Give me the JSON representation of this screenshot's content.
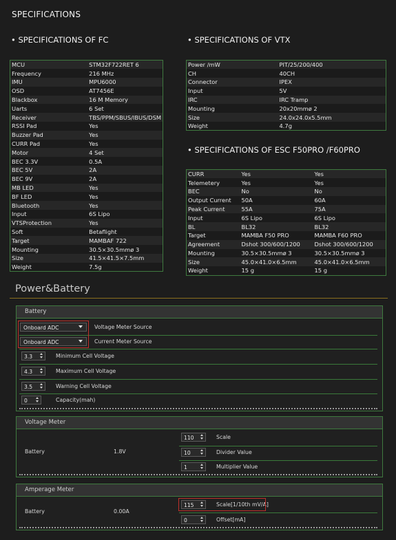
{
  "page_title": "SPECIFICATIONS",
  "fc": {
    "title": "• SPECIFICATIONS OF FC",
    "rows": [
      [
        "MCU",
        "STM32F722RET 6"
      ],
      [
        "Frequency",
        "216 MHz"
      ],
      [
        "IMU",
        "MPU6000"
      ],
      [
        "OSD",
        "AT7456E"
      ],
      [
        "Blackbox",
        "16 M Memory"
      ],
      [
        "Uarts",
        "6 Set"
      ],
      [
        "Receiver",
        "TBS/PPM/SBUS/IBUS/DSM"
      ],
      [
        "RSSI Pad",
        "Yes"
      ],
      [
        "Buzzer Pad",
        "Yes"
      ],
      [
        "CURR Pad",
        "Yes"
      ],
      [
        "Motor",
        "4 Set"
      ],
      [
        "BEC 3.3V",
        "0.5A"
      ],
      [
        "BEC 5V",
        "2A"
      ],
      [
        "BEC 9V",
        "2A"
      ],
      [
        "MB LED",
        "Yes"
      ],
      [
        "BF LED",
        "Yes"
      ],
      [
        "Bluetooth",
        "Yes"
      ],
      [
        "Input",
        "6S Lipo"
      ],
      [
        "VTSProtection",
        "Yes"
      ],
      [
        "Soft",
        "Betaflight"
      ],
      [
        "Target",
        "MAMBAF 722"
      ],
      [
        "Mounting",
        "30.5×30.5mmø 3"
      ],
      [
        "Size",
        "41.5×41.5×7.5mm"
      ],
      [
        "Weight",
        "7.5g"
      ]
    ]
  },
  "vtx": {
    "title": "• SPECIFICATIONS OF VTX",
    "rows": [
      [
        "Power /mW",
        "PIT/25/200/400"
      ],
      [
        "CH",
        "40CH"
      ],
      [
        "Connector",
        "IPEX"
      ],
      [
        "Input",
        "5V"
      ],
      [
        "IRC",
        "IRC Tramp"
      ],
      [
        "Mounting",
        "20x20mmø 2"
      ],
      [
        "Size",
        "24.0x24.0x5.5mm"
      ],
      [
        "Weight",
        "4.7g"
      ]
    ]
  },
  "esc": {
    "title": "• SPECIFICATIONS OF ESC F50PRO /F60PRO",
    "rows": [
      [
        "CURR",
        "Yes",
        "Yes"
      ],
      [
        "Telemetery",
        "Yes",
        "Yes"
      ],
      [
        "BEC",
        "No",
        "No"
      ],
      [
        "Output Current",
        "50A",
        "60A"
      ],
      [
        "Peak Current",
        "55A",
        "75A"
      ],
      [
        "Input",
        "6S Lipo",
        "6S Lipo"
      ],
      [
        "BL",
        "BL32",
        "BL32"
      ],
      [
        "Target",
        "MAMBA F50 PRO",
        "MAMBA F60 PRO"
      ],
      [
        "Agreement",
        "Dshot 300/600/1200",
        "Dshot 300/600/1200"
      ],
      [
        "Mounting",
        "30.5×30.5mmø 3",
        "30.5×30.5mmø 3"
      ],
      [
        "Size",
        "45.0×41.0×6.5mm",
        "45.0×41.0×6.5mm"
      ],
      [
        "Weight",
        "15 g",
        "15 g"
      ]
    ]
  },
  "power": {
    "title": "Power&Battery",
    "battery": {
      "header": "Battery",
      "voltage_source": {
        "value": "Onboard ADC",
        "label": "Voltage Meter Source"
      },
      "current_source": {
        "value": "Onboard ADC",
        "label": "Current Meter Source"
      },
      "min_cell": {
        "value": "3.3",
        "label": "Minimum Cell Voltage"
      },
      "max_cell": {
        "value": "4.3",
        "label": "Maximum Cell Voltage"
      },
      "warn_cell": {
        "value": "3.5",
        "label": "Warning Cell Voltage"
      },
      "capacity": {
        "value": "0",
        "label": "Capacity(mah)"
      }
    },
    "voltage_meter": {
      "header": "Voltage Meter",
      "name": "Battery",
      "reading": "1.8V",
      "scale": {
        "value": "110",
        "label": "Scale"
      },
      "divider": {
        "value": "10",
        "label": "Divider Value"
      },
      "multiplier": {
        "value": "1",
        "label": "Multiplier Value"
      }
    },
    "amperage_meter": {
      "header": "Amperage Meter",
      "name": "Battery",
      "reading": "0.00A",
      "scale": {
        "value": "115",
        "label": "Scale[1/10th mV/A]"
      },
      "offset": {
        "value": "0",
        "label": "Offset[mA]"
      }
    }
  }
}
